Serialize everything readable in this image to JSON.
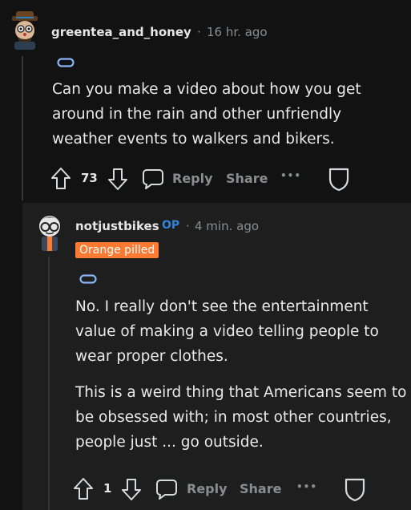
{
  "comments": [
    {
      "author": "greentea_and_honey",
      "time": "16 hr. ago",
      "body": "Can you make a video about how you get around in the rain and other unfriendly weather events to walkers and bikers.",
      "votes": "73",
      "actions": {
        "reply": "Reply",
        "share": "Share",
        "more": "•••"
      }
    },
    {
      "author": "notjustbikes",
      "op_badge": "OP",
      "time": "4 min. ago",
      "flair": "Orange pilled",
      "body_paragraphs": [
        "No. I really don't see the entertainment value of making a video telling people to wear proper clothes.",
        "This is a weird thing that Americans seem to be obsessed with; in most other countries, people just ... go outside."
      ],
      "votes": "1",
      "actions": {
        "reply": "Reply",
        "share": "Share",
        "more": "•••"
      }
    }
  ],
  "separator": "·",
  "colors": {
    "background": "#121212",
    "reply_background": "#1e1e1e",
    "flair": "#ff7a33",
    "op": "#2f84d8"
  }
}
